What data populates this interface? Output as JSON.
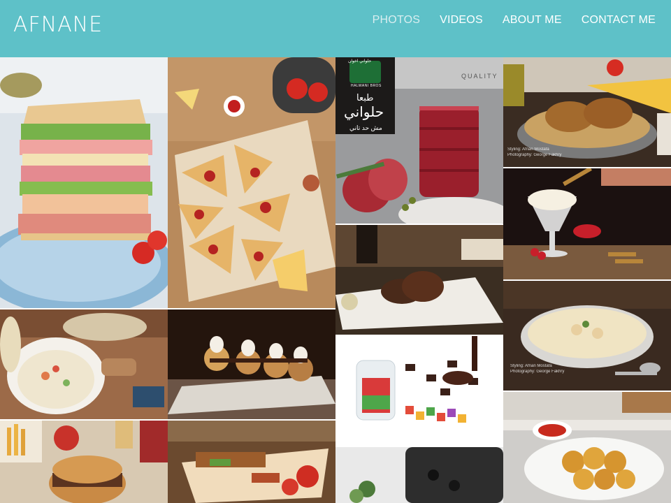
{
  "site": {
    "logo": "AFNANE"
  },
  "nav": {
    "items": [
      {
        "label": "PHOTOS",
        "active": true
      },
      {
        "label": "VIDEOS",
        "active": false
      },
      {
        "label": "ABOUT ME",
        "active": false
      },
      {
        "label": "CONTACT ME",
        "active": false
      }
    ]
  },
  "colors": {
    "header_bg": "#5ec1c8",
    "header_text": "#ffffff",
    "active_nav": "#d9eef0"
  },
  "gallery": {
    "halwani": {
      "brand_ar": "حلواني اخوان",
      "brand_en": "HALWANI BROS",
      "tagline_ar_1": "طبعا",
      "tagline_ar_2": "حلواني",
      "tagline_ar_3": "مش حد تاني",
      "badge": "QUALITY"
    },
    "credits": {
      "styling": "Styling: Afnan Mostafa",
      "photography": "Photography: George Fakhry"
    }
  }
}
